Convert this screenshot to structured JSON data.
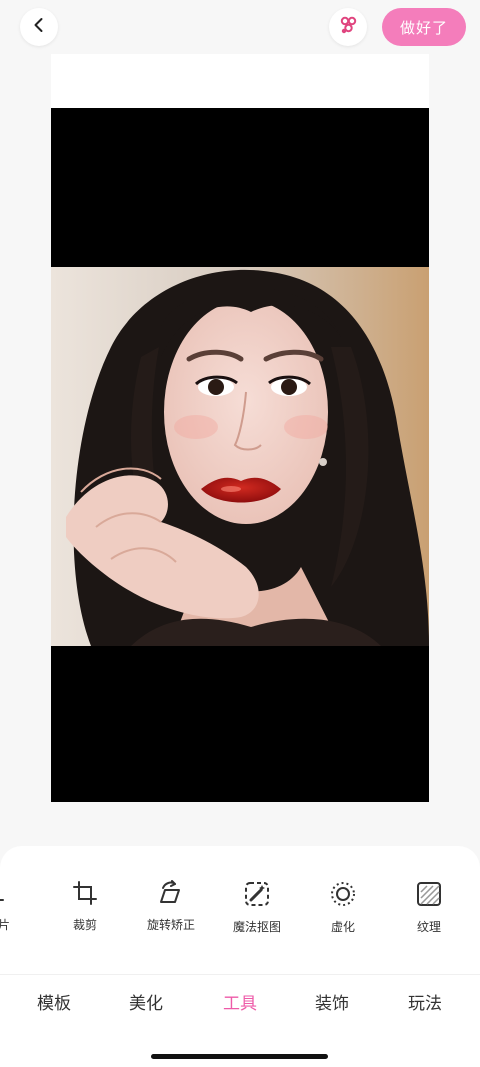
{
  "header": {
    "done_label": "做好了"
  },
  "colors": {
    "accent": "#f47dbb",
    "accent_text": "#ee5aa8",
    "compare_icon": "#e0457f"
  },
  "tools": [
    {
      "label": "废片",
      "icon": "partial-edit-icon"
    },
    {
      "label": "裁剪",
      "icon": "crop-icon"
    },
    {
      "label": "旋转矫正",
      "icon": "rotate-icon"
    },
    {
      "label": "魔法抠图",
      "icon": "magic-cutout-icon"
    },
    {
      "label": "虚化",
      "icon": "blur-icon"
    },
    {
      "label": "纹理",
      "icon": "texture-icon"
    }
  ],
  "tabs": [
    {
      "label": "模板",
      "active": false
    },
    {
      "label": "美化",
      "active": false
    },
    {
      "label": "工具",
      "active": true
    },
    {
      "label": "装饰",
      "active": false
    },
    {
      "label": "玩法",
      "active": false
    }
  ]
}
